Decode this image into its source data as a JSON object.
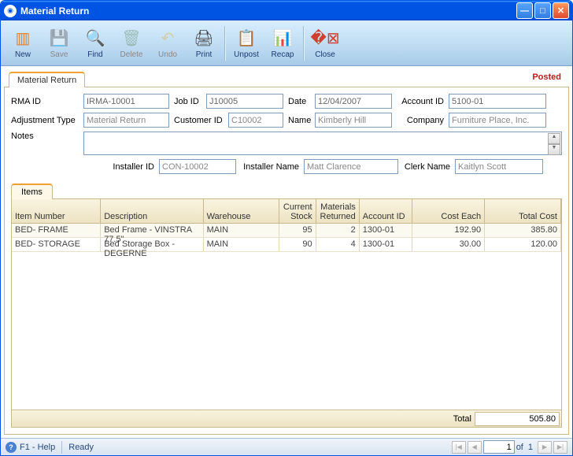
{
  "window": {
    "title": "Material Return"
  },
  "toolbar": {
    "new": "New",
    "save": "Save",
    "find": "Find",
    "delete": "Delete",
    "undo": "Undo",
    "print": "Print",
    "unpost": "Unpost",
    "recap": "Recap",
    "close": "Close"
  },
  "tabs": {
    "main": "Material Return",
    "status": "Posted"
  },
  "form": {
    "rma_id_lbl": "RMA ID",
    "rma_id": "IRMA-10001",
    "job_id_lbl": "Job ID",
    "job_id": "J10005",
    "date_lbl": "Date",
    "date": "12/04/2007",
    "account_id_lbl": "Account ID",
    "account_id": "5100-01",
    "adj_type_lbl": "Adjustment Type",
    "adj_type": "Material Return",
    "customer_id_lbl": "Customer ID",
    "customer_id": "C10002",
    "name_lbl": "Name",
    "name": "Kimberly Hill",
    "company_lbl": "Company",
    "company": "Furniture Place, Inc.",
    "notes_lbl": "Notes",
    "notes": "",
    "installer_id_lbl": "Installer ID",
    "installer_id": "CON-10002",
    "installer_name_lbl": "Installer Name",
    "installer_name": "Matt Clarence",
    "clerk_name_lbl": "Clerk Name",
    "clerk_name": "Kaitlyn Scott"
  },
  "items": {
    "tab": "Items",
    "headers": {
      "item_number": "Item Number",
      "description": "Description",
      "warehouse": "Warehouse",
      "current_stock": "Current Stock",
      "materials_returned": "Materials Returned",
      "account_id": "Account ID",
      "cost_each": "Cost Each",
      "total_cost": "Total Cost"
    },
    "rows": [
      {
        "item_number": "BED- FRAME",
        "description": "Bed Frame - VINSTRA 77.5\"",
        "warehouse": "MAIN",
        "current_stock": "95",
        "materials_returned": "2",
        "account_id": "1300-01",
        "cost_each": "192.90",
        "total_cost": "385.80"
      },
      {
        "item_number": "BED- STORAGE",
        "description": "Bed Storage Box - DEGERNE",
        "warehouse": "MAIN",
        "current_stock": "90",
        "materials_returned": "4",
        "account_id": "1300-01",
        "cost_each": "30.00",
        "total_cost": "120.00"
      }
    ],
    "footer": {
      "total_lbl": "Total",
      "total_val": "505.80"
    }
  },
  "statusbar": {
    "help": "F1 - Help",
    "ready": "Ready",
    "page": "1",
    "of": "of",
    "pages": "1"
  }
}
